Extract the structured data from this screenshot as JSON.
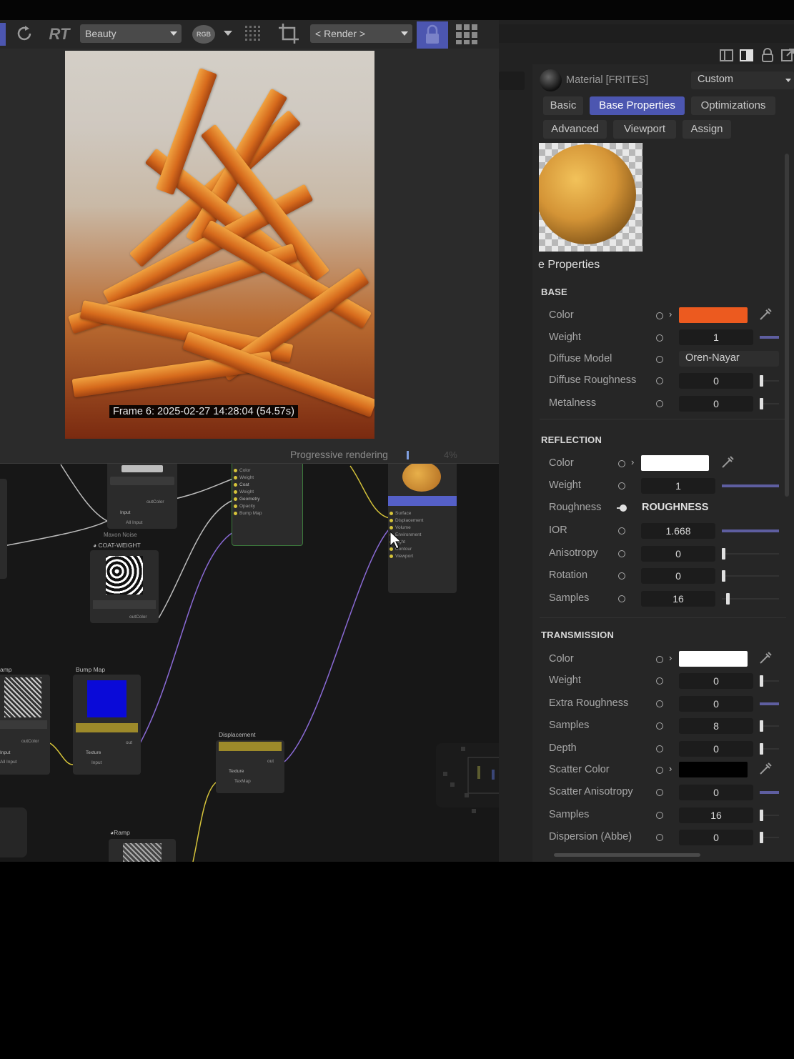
{
  "toolbar": {
    "rt_label": "RT",
    "pass_dropdown": "Beauty",
    "rgb_label": "RGB",
    "render_dropdown": "< Render >"
  },
  "viewer": {
    "frame_label": "Frame  6:  2025-02-27  14:28:04  (54.57s)",
    "progress_label": "Progressive rendering",
    "progress_percent_text": "4%",
    "progress_fraction": 0.04
  },
  "node_editor": {
    "nodes": {
      "noise_label": "Maxon Noise",
      "coat_weight": "COAT-WEIGHT",
      "ramp_left": "amp",
      "bump_map": "Bump Map",
      "displacement": "Displacement",
      "ramp_bottom": "Ramp"
    },
    "ports": {
      "input": "Input",
      "all_input": "All Input",
      "out_color": "outColor",
      "color": "Color",
      "weight": "Weight",
      "coat": "Coat",
      "geometry": "Geometry",
      "opacity": "Opacity",
      "bump_map": "Bump Map",
      "surface": "Surface",
      "displacement": "Displacement",
      "volume": "Volume",
      "environment": "Environment",
      "light": "Light",
      "contour": "Contour",
      "viewport": "Viewport",
      "texture": "Texture",
      "out": "out",
      "tex_map": "TexMap"
    }
  },
  "material": {
    "title": "Material [FRITES]",
    "preset": "Custom",
    "tabs": [
      "Basic",
      "Base Properties",
      "Optimizations",
      "Advanced",
      "Viewport",
      "Assign"
    ],
    "active_tab": "Base Properties",
    "section_heading": "e Properties"
  },
  "base": {
    "heading": "BASE",
    "color_label": "Color",
    "color_value": "#ec5a1f",
    "weight_label": "Weight",
    "weight_value": "1",
    "diffuse_model_label": "Diffuse Model",
    "diffuse_model_value": "Oren-Nayar",
    "diffuse_roughness_label": "Diffuse Roughness",
    "diffuse_roughness_value": "0",
    "metalness_label": "Metalness",
    "metalness_value": "0"
  },
  "reflection": {
    "heading": "REFLECTION",
    "color_label": "Color",
    "color_value": "#ffffff",
    "weight_label": "Weight",
    "weight_value": "1",
    "roughness_label": "Roughness",
    "roughness_value": "ROUGHNESS",
    "ior_label": "IOR",
    "ior_value": "1.668",
    "anisotropy_label": "Anisotropy",
    "anisotropy_value": "0",
    "rotation_label": "Rotation",
    "rotation_value": "0",
    "samples_label": "Samples",
    "samples_value": "16"
  },
  "transmission": {
    "heading": "TRANSMISSION",
    "color_label": "Color",
    "color_value": "#ffffff",
    "weight_label": "Weight",
    "weight_value": "0",
    "extra_roughness_label": "Extra Roughness",
    "extra_roughness_value": "0",
    "samples_label": "Samples",
    "samples_value": "8",
    "depth_label": "Depth",
    "depth_value": "0",
    "scatter_color_label": "Scatter Color",
    "scatter_color_value": "#000000",
    "scatter_anisotropy_label": "Scatter Anisotropy",
    "scatter_anisotropy_value": "0",
    "samples2_label": "Samples",
    "samples2_value": "16",
    "dispersion_label": "Dispersion (Abbe)",
    "dispersion_value": "0"
  },
  "colors": {
    "accent": "#4c56b0",
    "base_swatch": "#ec5a1f"
  },
  "icons": [
    "refresh-icon",
    "grid-icon",
    "crop-icon",
    "lock-icon",
    "apps-icon",
    "layout-icon",
    "panel-icon",
    "pin-icon",
    "popout-icon",
    "eyedropper-icon",
    "mouse-cursor-icon"
  ]
}
